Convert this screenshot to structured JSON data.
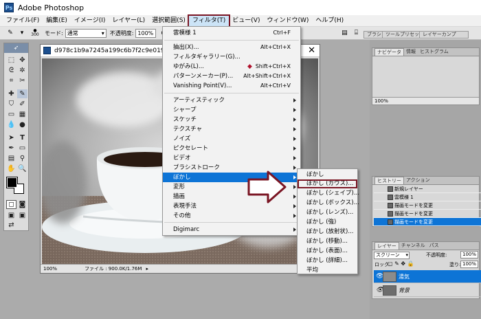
{
  "app": {
    "title": "Adobe Photoshop",
    "icon_text": "Ps"
  },
  "menubar": {
    "items": [
      "ファイル(F)",
      "編集(E)",
      "イメージ(I)",
      "レイヤー(L)",
      "選択範囲(S)",
      "フィルタ(T)",
      "ビュー(V)",
      "ウィンドウ(W)",
      "ヘルプ(H)"
    ],
    "active_index": 5
  },
  "options": {
    "brush_size": "300",
    "mode_label": "モード:",
    "mode_value": "通常",
    "opacity_label": "不透明度:",
    "opacity_value": "100%"
  },
  "palette_well": {
    "tabs": [
      "ブラシ",
      "ツールプリセット",
      "レイヤーカンプ"
    ]
  },
  "document": {
    "title": "d978c1b9a7245a199c6b7f2c9e019a62",
    "zoom": "100%",
    "file_info": "ファイル : 900.0K/1.76M"
  },
  "filter_menu": {
    "last_filter": {
      "label": "雲模様 1",
      "shortcut": "Ctrl+F"
    },
    "group1": [
      {
        "label": "抽出(X)...",
        "shortcut": "Alt+Ctrl+X"
      },
      {
        "label": "フィルタギャラリー(G)...",
        "shortcut": ""
      },
      {
        "label": "ゆがみ(L)...",
        "shortcut": "Shift+Ctrl+X"
      },
      {
        "label": "パターンメーカー(P)...",
        "shortcut": "Alt+Shift+Ctrl+X"
      },
      {
        "label": "Vanishing Point(V)...",
        "shortcut": "Alt+Ctrl+V"
      }
    ],
    "group2": [
      "アーティスティック",
      "シャープ",
      "スケッチ",
      "テクスチャ",
      "ノイズ",
      "ピクセレート",
      "ビデオ",
      "ブラシストローク",
      "ぼかし",
      "変形",
      "描画",
      "表現手法",
      "その他"
    ],
    "highlighted_index": 8,
    "digimarc": "Digimarc"
  },
  "blur_submenu": {
    "items": [
      "ぼかし",
      "ぼかし (ガウス)...",
      "ぼかし (シェイプ)...",
      "ぼかし (ボックス)...",
      "ぼかし (レンズ)...",
      "ぼかし (強)",
      "ぼかし (放射状)...",
      "ぼかし (移動)...",
      "ぼかし (表面)...",
      "ぼかし (詳細)...",
      "平均"
    ],
    "boxed_index": 1
  },
  "navigator": {
    "tabs": [
      "ナビゲータ",
      "情報",
      "ヒストグラム"
    ],
    "zoom": "100%"
  },
  "history": {
    "tabs": [
      "ヒストリー",
      "アクション"
    ],
    "rows": [
      "新規レイヤー",
      "雲模様 1",
      "描画モードを変更",
      "描画モードを変更",
      "描画モードを変更"
    ],
    "selected_index": 4
  },
  "layers": {
    "tabs": [
      "レイヤー",
      "チャンネル",
      "パス"
    ],
    "blend_mode": "スクリーン",
    "opacity_label": "不透明度:",
    "opacity_value": "100%",
    "lock_label": "ロック:",
    "fill_label": "塗り:",
    "fill_value": "100%",
    "rows": [
      {
        "name": "湯気",
        "selected": true
      },
      {
        "name": "背景",
        "selected": false
      }
    ]
  },
  "colors": {
    "highlight": "#0d74d6",
    "annotation": "#7a1523"
  }
}
